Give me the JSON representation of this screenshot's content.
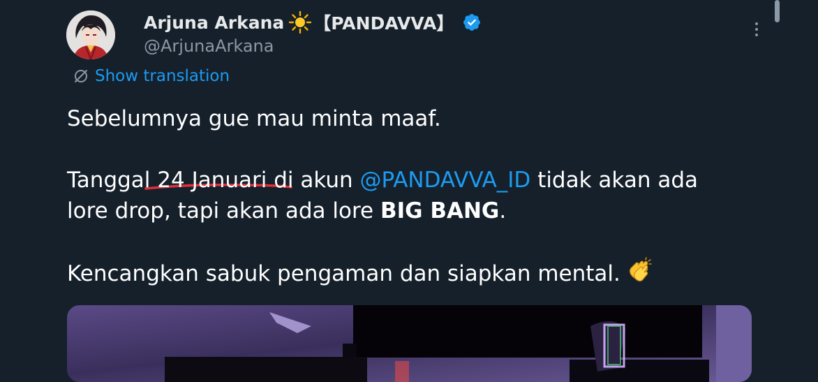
{
  "tweet": {
    "display_name": "Arjuna Arkana",
    "name_tag": "【PANDAVVA】",
    "handle": "@ArjunaArkana",
    "show_translation": "Show translation",
    "paragraphs": {
      "p1": "Sebelumnya gue mau minta maaf.",
      "p2_before": "Tanggal 24 Januari di akun ",
      "p2_mention": "@PANDAVVA_ID",
      "p2_after": " tidak akan ada",
      "p3_before": "lore drop, tapi akan ada lore ",
      "p3_bold": "BIG BANG",
      "p3_after": ".",
      "p4": "Kencangkan sabuk pengaman dan siapkan mental."
    }
  },
  "colors": {
    "background": "#15202b",
    "accent": "#1d9bf0",
    "secondary_text": "#8b98a5",
    "primary_text": "#ffffff",
    "annotation_underline": "#e0313a"
  },
  "icons": {
    "sun": "sun-icon",
    "verified": "verified-badge-icon",
    "translate": "translate-icon",
    "more": "more-options-icon",
    "clap": "clapping-hands-emoji"
  }
}
